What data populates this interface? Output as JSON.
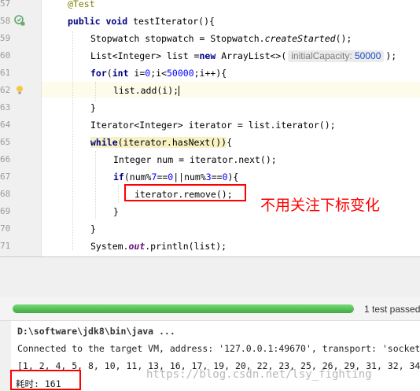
{
  "editor": {
    "line_numbers": [
      "57",
      "58",
      "59",
      "60",
      "61",
      "62",
      "63",
      "64",
      "65",
      "66",
      "67",
      "68",
      "69",
      "70",
      "71"
    ],
    "lines": [
      {
        "text": "@Test"
      },
      {
        "t1": "public void ",
        "t2": "testIterator(){"
      },
      {
        "t1": "Stopwatch stopwatch = Stopwatch.",
        "t2": "createStarted",
        "t3": "();"
      },
      {
        "t1": "List<Integer> list =",
        "t2": "new ",
        "t3": "ArrayList<>(",
        "hint_name": "initialCapacity:",
        "hint_value": "50000",
        "t4": ");"
      },
      {
        "t1": "for",
        "t2": "(",
        "t3": "int ",
        "t4": "i=",
        "t5": "0",
        "t6": ";i<",
        "t7": "50000",
        "t8": ";i++){"
      },
      {
        "text": "list.add(i);"
      },
      {
        "text": "}"
      },
      {
        "t1": "Iterator<Integer> iterator = list.iterator();"
      },
      {
        "t1": "while",
        "t2": "(iterator.hasNext())",
        "t3": "{"
      },
      {
        "t1": "Integer num = iterator.next();"
      },
      {
        "t1": "if",
        "t2": "(num%",
        "t3": "7",
        "t4": "==",
        "t5": "0",
        "t6": "||num%",
        "t7": "3",
        "t8": "==",
        "t9": "0",
        "t10": "){"
      },
      {
        "text": "iterator.remove();"
      },
      {
        "text": "}"
      },
      {
        "text": "}"
      },
      {
        "t1": "System.",
        "t2": "out",
        "t3": ".println(list);"
      }
    ],
    "annotation": "不用关注下标变化"
  },
  "run": {
    "progress": 1.0,
    "status": "1 test passed",
    "console": [
      "D:\\software\\jdk8\\bin\\java ...",
      "Connected to the target VM, address: '127.0.0.1:49670', transport: 'socket'",
      "[1, 2, 4, 5, 8, 10, 11, 13, 16, 17, 19, 20, 22, 23, 25, 26, 29, 31, 32, 34",
      "耗时: 161"
    ],
    "watermark": "https://blog.csdn.net/lsy_fighting"
  },
  "colors": {
    "keyword": "#000080",
    "number": "#0000ff",
    "annotation": "#808000",
    "highlight_red": "#ff0000",
    "progress_green": "#3faa3f"
  }
}
